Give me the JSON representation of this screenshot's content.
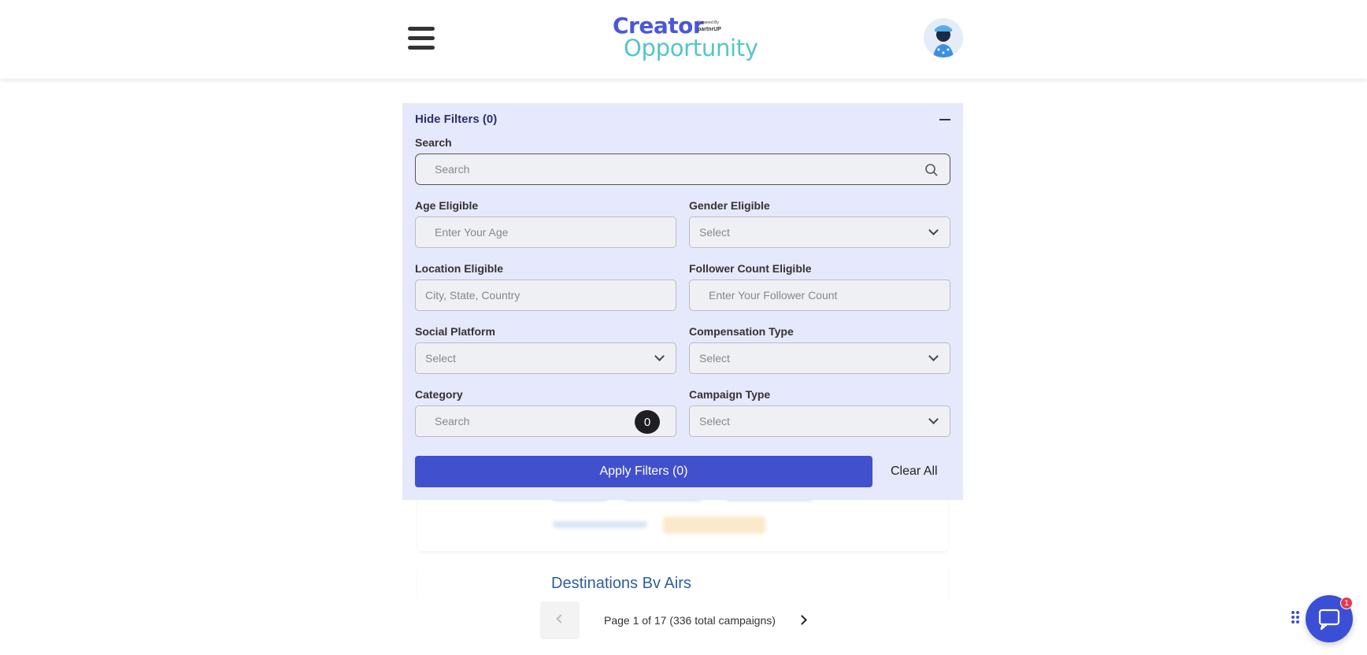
{
  "header": {
    "logo_line1": "Creator",
    "logo_line2": "Opportunity",
    "logo_powered": "Powered By",
    "logo_partner": "partnrUP"
  },
  "filters": {
    "toggle_label": "Hide Filters (0)",
    "search": {
      "label": "Search",
      "placeholder": "Search"
    },
    "age": {
      "label": "Age Eligible",
      "placeholder": "Enter Your Age"
    },
    "gender": {
      "label": "Gender Eligible",
      "value": "Select"
    },
    "location": {
      "label": "Location Eligible",
      "placeholder": "City, State, Country"
    },
    "follower": {
      "label": "Follower Count Eligible",
      "placeholder": "Enter Your Follower Count"
    },
    "social": {
      "label": "Social Platform",
      "value": "Select"
    },
    "compensation": {
      "label": "Compensation Type",
      "value": "Select"
    },
    "category": {
      "label": "Category",
      "placeholder": "Search",
      "count": "0"
    },
    "campaign": {
      "label": "Campaign Type",
      "value": "Select"
    },
    "apply_label": "Apply Filters (0)",
    "clear_label": "Clear All"
  },
  "campaigns": {
    "second_card_title": "Destinations Bv Airs"
  },
  "pagination": {
    "text": "Page 1 of 17 (336 total campaigns)"
  },
  "chat": {
    "badge": "1"
  },
  "colors": {
    "primary": "#4150cc",
    "panel_bg": "#e6e8fb",
    "logo_blue": "#4b57d8",
    "logo_teal": "#53c6c6"
  }
}
